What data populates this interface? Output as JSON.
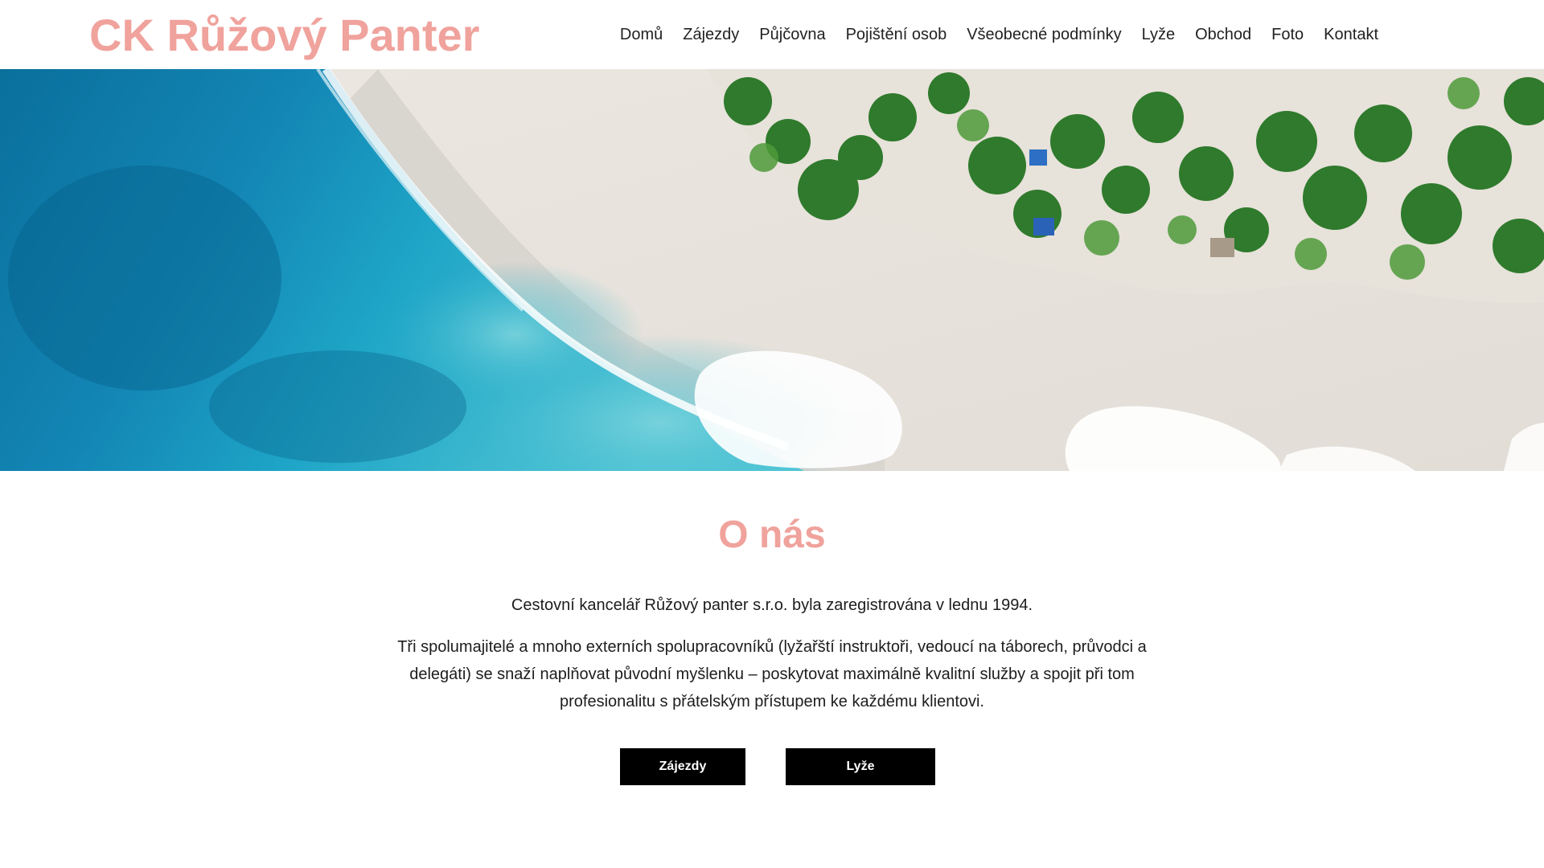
{
  "brand": {
    "name": "CK Růžový Panter",
    "accent_color": "#f0a29c"
  },
  "nav": {
    "items": [
      {
        "label": "Domů"
      },
      {
        "label": "Zájezdy"
      },
      {
        "label": "Půjčovna"
      },
      {
        "label": "Pojištění osob"
      },
      {
        "label": "Všeobecné podmínky"
      },
      {
        "label": "Lyže"
      },
      {
        "label": "Obchod"
      },
      {
        "label": "Foto"
      },
      {
        "label": "Kontakt"
      }
    ]
  },
  "hero": {
    "image": "aerial-beach-photo"
  },
  "about": {
    "title": "O nás",
    "paragraph1": "Cestovní kancelář Růžový panter s.r.o. byla zaregistrována v lednu 1994.",
    "paragraph2": "Tři spolumajitelé a mnoho externích spolupracovníků (lyžařští instruktoři, vedoucí na táborech, průvodci a delegáti) se snaží naplňovat původní myšlenku – poskytovat maximálně kvalitní služby a spojit při tom profesionalitu s přátelským přístupem ke každému klientovi.",
    "buttons": [
      {
        "label": "Zájezdy"
      },
      {
        "label": "Lyže"
      }
    ]
  }
}
